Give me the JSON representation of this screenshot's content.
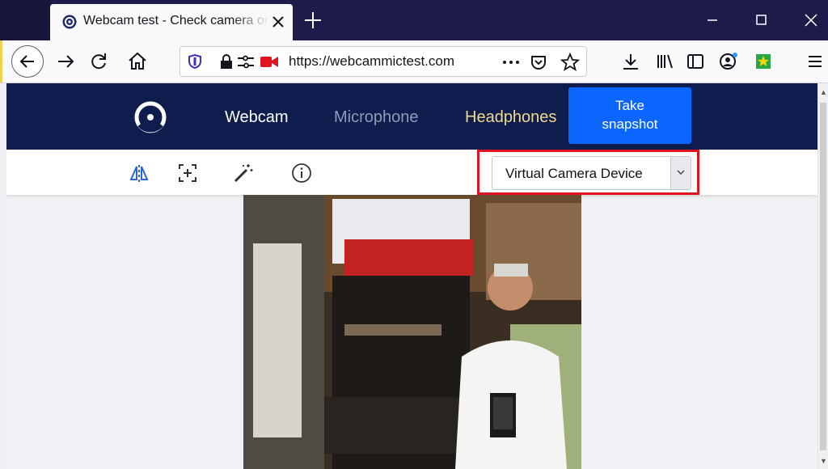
{
  "browser": {
    "tab_title": "Webcam test - Check camera online",
    "url": "https://webcammictest.com"
  },
  "site": {
    "nav": {
      "webcam": "Webcam",
      "microphone": "Microphone",
      "headphones": "Headphones"
    },
    "snapshot_label_line1": "Take",
    "snapshot_label_line2": "snapshot",
    "camera_select": {
      "selected": "Virtual Camera Device"
    },
    "toolbar_icons": [
      "mirror-icon",
      "fullscreen-capture-icon",
      "magic-wand-icon",
      "info-icon"
    ]
  },
  "colors": {
    "header_bg": "#0e1d4e",
    "accent": "#0a66ff",
    "highlight": "#e0141e",
    "nav_active": "#ffffff",
    "nav_inactive": "#8f9bb5",
    "nav_headphones": "#f0d98c"
  }
}
